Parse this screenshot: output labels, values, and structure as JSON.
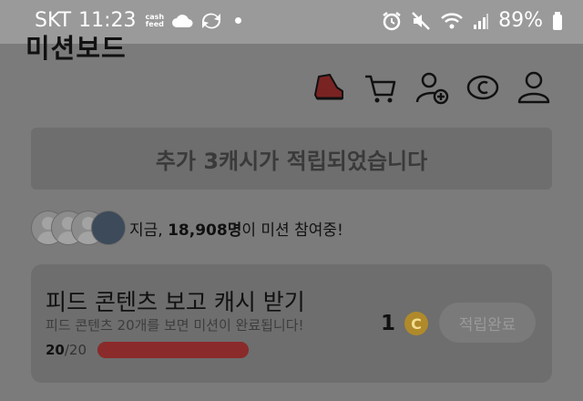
{
  "status_bar": {
    "carrier": "SKT",
    "time": "11:23",
    "cashfeed_line1": "cash",
    "cashfeed_line2": "feed",
    "battery": "89%"
  },
  "header": {
    "title": "미션보드",
    "icons": [
      "sneaker-icon",
      "cart-icon",
      "add-friend-icon",
      "cash-coin-icon",
      "profile-icon"
    ]
  },
  "banner": {
    "text": "추가 3캐시가 적립되었습니다"
  },
  "participants": {
    "prefix": "지금, ",
    "count": "18,908명",
    "suffix": "이 미션 참여중!"
  },
  "mission": {
    "title": "피드 콘텐츠 보고 캐시 받기",
    "description": "피드 콘텐츠 20개를 보면 미션이 완료됩니다!",
    "progress_current": "20",
    "progress_total": "/20",
    "progress_fraction": 1.0,
    "reward": "1",
    "coin_symbol": "C",
    "button_label": "적립완료"
  },
  "colors": {
    "progress_fill": "#8b2a2a",
    "coin": "#b08a2a"
  }
}
